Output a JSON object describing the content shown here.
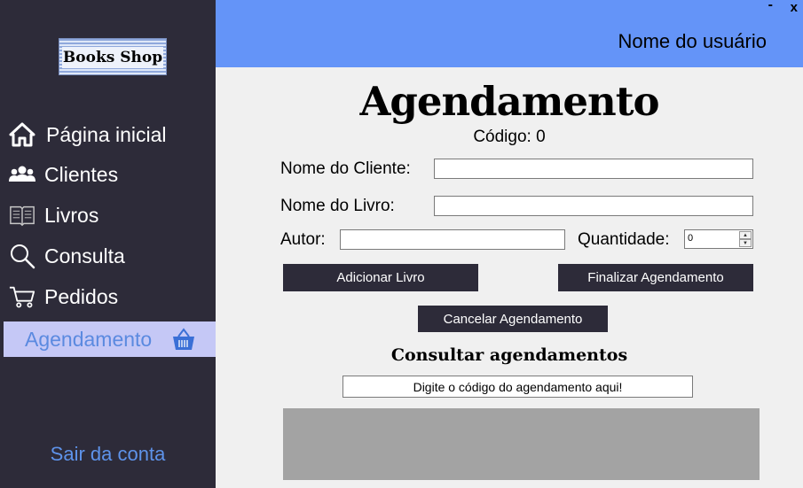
{
  "window": {
    "minimize_label": "-",
    "close_label": "x"
  },
  "sidebar": {
    "logo_text": "Books Shop",
    "items": [
      {
        "label": "Página inicial",
        "icon": "home-icon"
      },
      {
        "label": "Clientes",
        "icon": "users-icon"
      },
      {
        "label": "Livros",
        "icon": "book-icon"
      },
      {
        "label": "Consulta",
        "icon": "search-icon"
      },
      {
        "label": "Pedidos",
        "icon": "cart-icon"
      },
      {
        "label": "Agendamento",
        "icon": "basket-icon",
        "active": true
      }
    ],
    "logout_label": "Sair da conta"
  },
  "header": {
    "user_name": "Nome do usuário"
  },
  "main": {
    "title": "Agendamento",
    "code_label": "Código: 0",
    "form": {
      "client_label": "Nome do Cliente:",
      "client_value": "",
      "book_label": "Nome do Livro:",
      "book_value": "",
      "author_label": "Autor:",
      "author_value": "",
      "quantity_label": "Quantidade:",
      "quantity_value": "0"
    },
    "buttons": {
      "add_book": "Adicionar Livro",
      "finish": "Finalizar Agendamento",
      "cancel": "Cancelar Agendamento"
    },
    "consult": {
      "title": "Consultar agendamentos",
      "search_text": "Digite o código do agendamento aqui!"
    }
  },
  "colors": {
    "sidebar_bg": "#2d2b39",
    "header_bg": "#6494f8",
    "active_item_bg": "#c5c8f6",
    "active_item_text": "#5b8ae0",
    "logout_text": "#5e93ea",
    "button_bg": "#2d2b39",
    "results_bg": "#a3a3a3"
  }
}
